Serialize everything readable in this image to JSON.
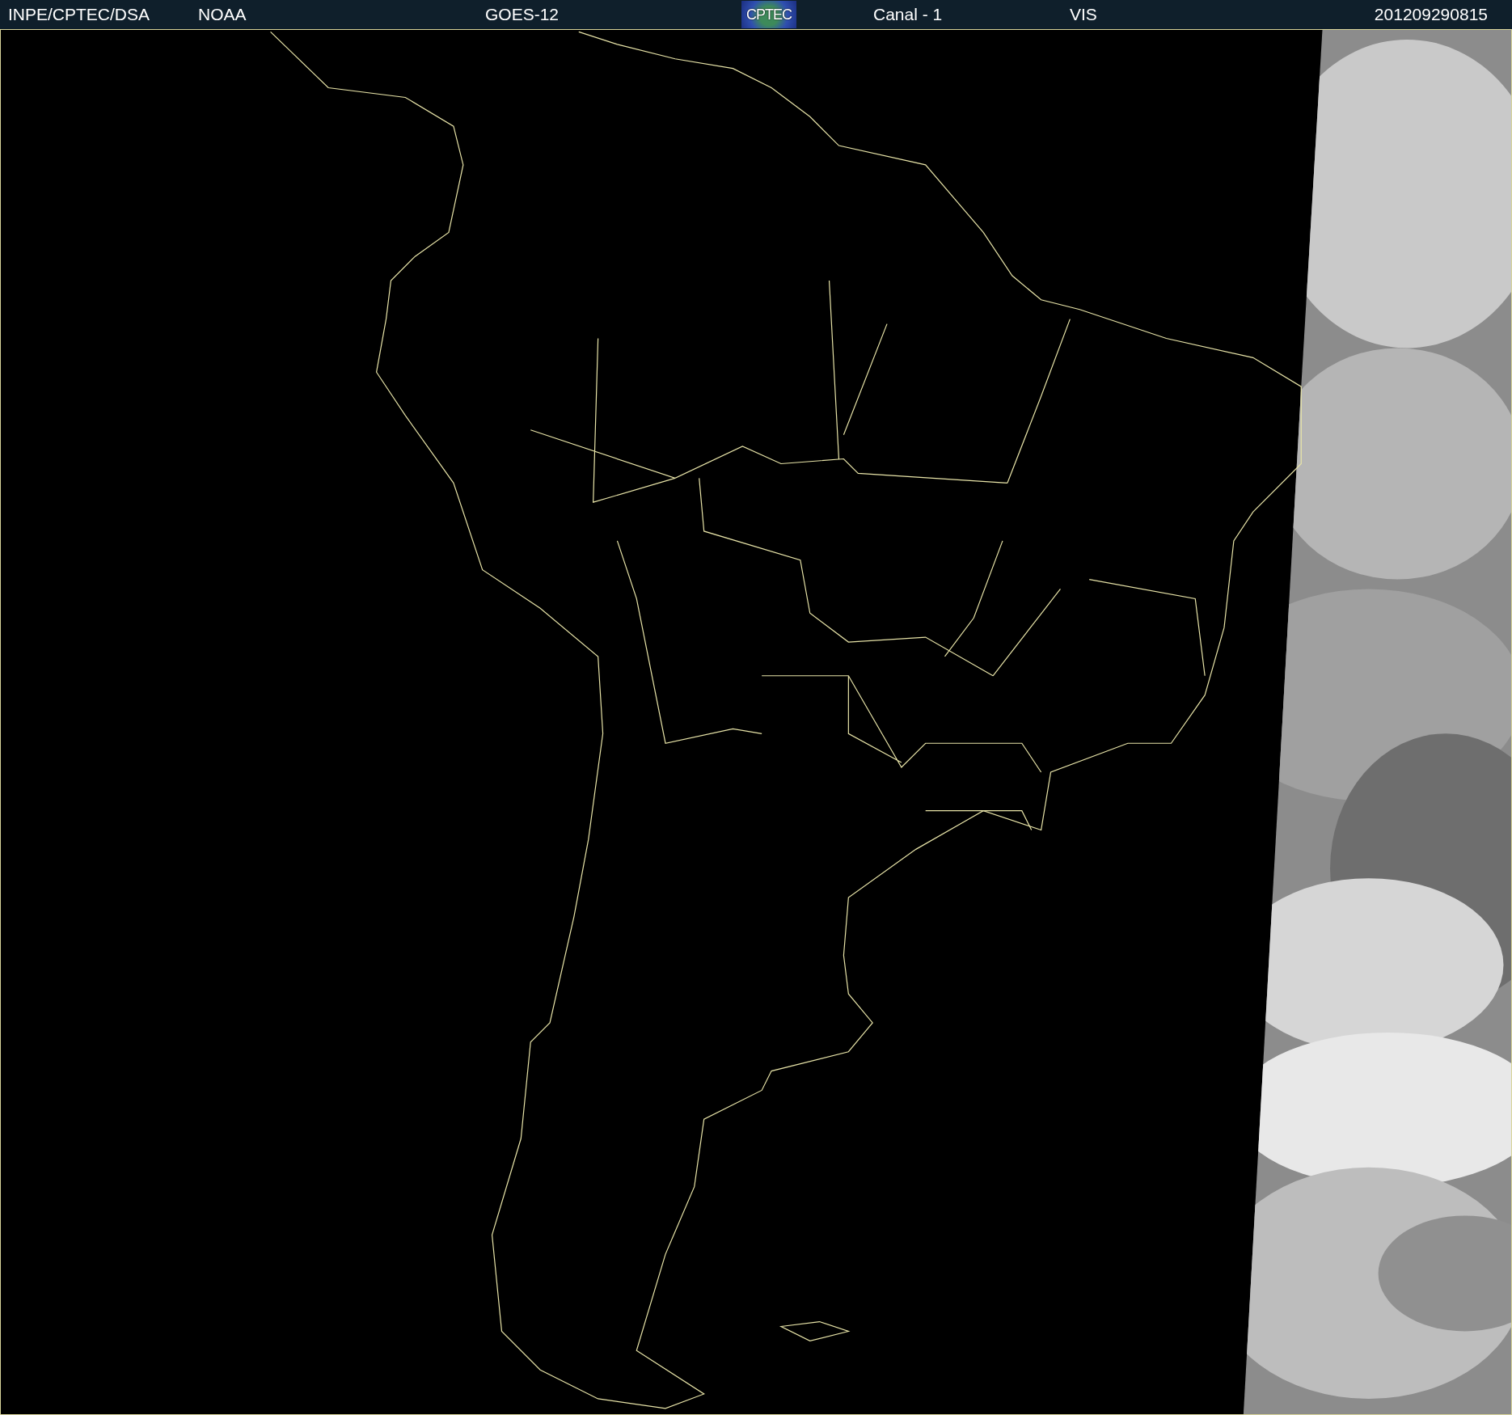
{
  "header": [
    {
      "kind": "text",
      "text": "INPE/CPTEC/DSA"
    },
    {
      "kind": "text",
      "text": "NOAA"
    },
    {
      "kind": "text",
      "text": "GOES-12"
    },
    {
      "kind": "logo",
      "text": "CPTEC"
    },
    {
      "kind": "text",
      "text": "Canal - 1"
    },
    {
      "kind": "text",
      "text": "VIS"
    },
    {
      "kind": "text",
      "text": "201209290815"
    }
  ]
}
